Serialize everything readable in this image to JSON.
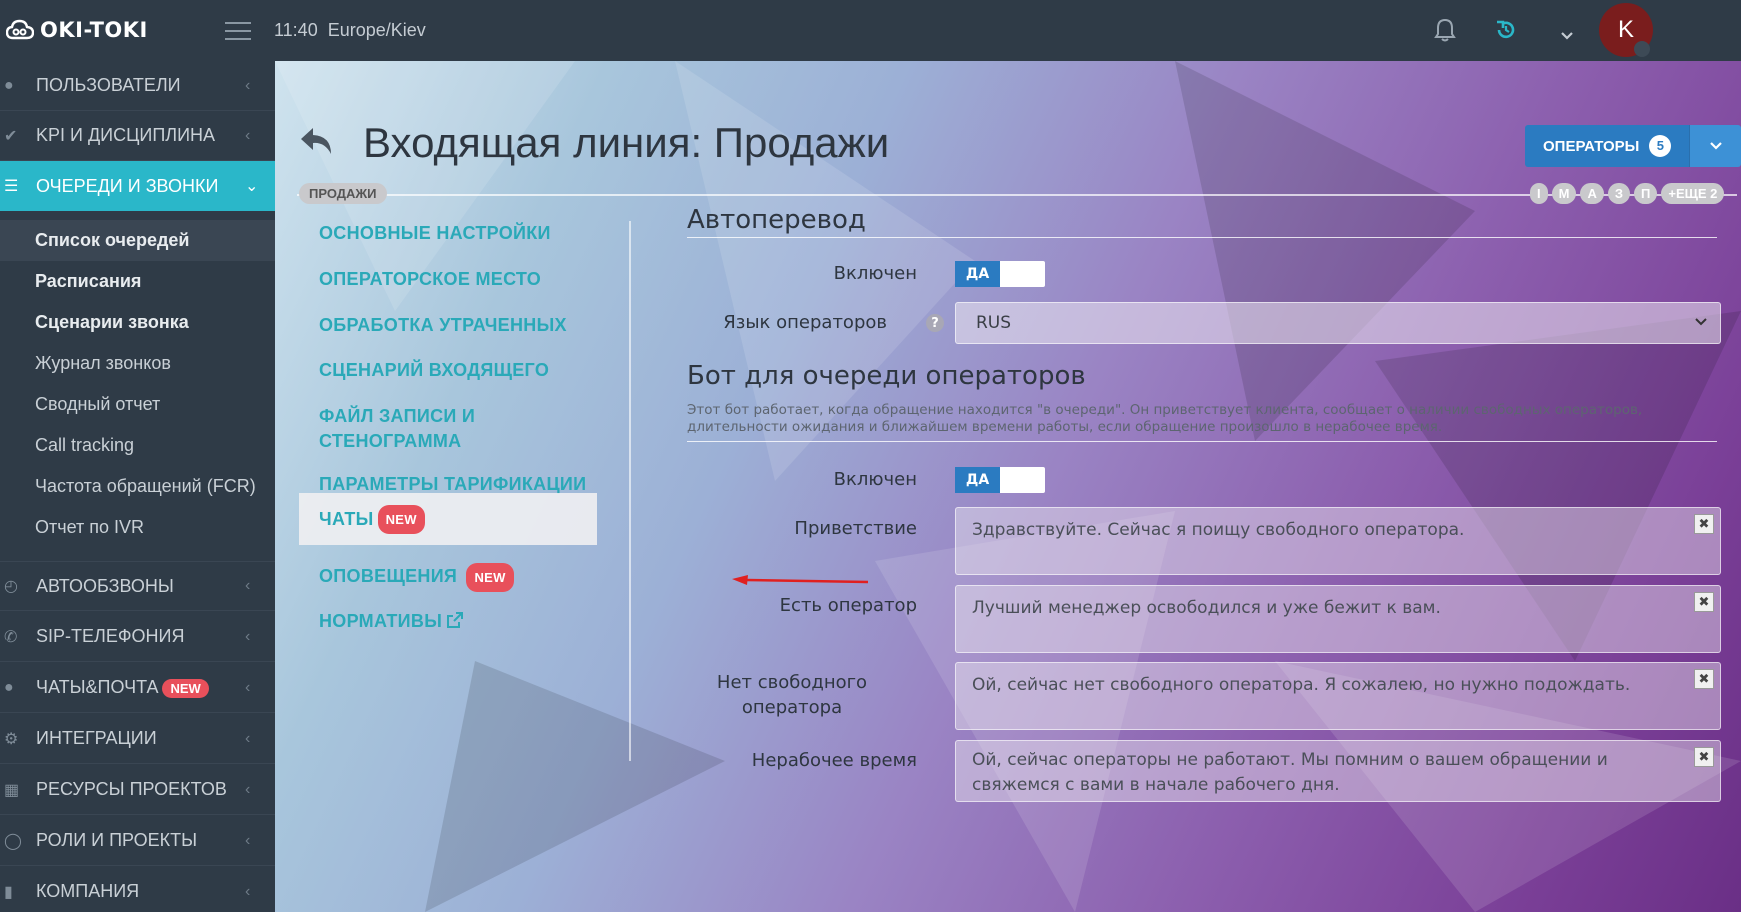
{
  "topbar": {
    "logo": "OKI-TOKI",
    "time": "11:40",
    "timezone": "Europe/Kiev",
    "avatar_letter": "K",
    "icons": [
      "menu-icon",
      "bell-icon",
      "refresh-icon",
      "chevron-down-icon"
    ]
  },
  "sidebar": {
    "items": [
      {
        "label": "ПОЛЬЗОВАТЕЛИ",
        "icon": "user-icon"
      },
      {
        "label": "KPI И ДИСЦИПЛИНА",
        "icon": "check-icon"
      },
      {
        "label": "ОЧЕРЕДИ И ЗВОНКИ",
        "icon": "list-icon",
        "active": true
      },
      {
        "label": "АВТООБЗВОНЫ",
        "icon": "clock-icon"
      },
      {
        "label": "SIP-ТЕЛЕФОНИЯ",
        "icon": "phone-icon"
      },
      {
        "label": "ЧАТЫ&ПОЧТА",
        "icon": "chat-icon",
        "badge": "NEW"
      },
      {
        "label": "ИНТЕГРАЦИИ",
        "icon": "gears-icon"
      },
      {
        "label": "РЕСУРСЫ ПРОЕКТОВ",
        "icon": "grid-icon"
      },
      {
        "label": "РОЛИ И ПРОЕКТЫ",
        "icon": "toggle-icon"
      },
      {
        "label": "КОМПАНИЯ",
        "icon": "bar-chart-icon"
      }
    ],
    "subitems": [
      {
        "label": "Список очередей"
      },
      {
        "label": "Расписания"
      },
      {
        "label": "Сценарии звонка"
      },
      {
        "label": "Журнал звонков"
      },
      {
        "label": "Сводный отчет"
      },
      {
        "label": "Call tracking"
      },
      {
        "label": "Частота обращений (FCR)"
      },
      {
        "label": "Отчет по IVR"
      }
    ]
  },
  "header": {
    "title": "Входящая линия: Продажи",
    "breadcrumb": "ПРОДАЖИ",
    "operators_label": "ОПЕРАТОРЫ",
    "operators_count": "5",
    "operator_pills": [
      "I",
      "M",
      "A",
      "З",
      "П",
      "+ЕЩЕ 2"
    ]
  },
  "settings_menu": [
    {
      "label": "ОСНОВНЫЕ НАСТРОЙКИ"
    },
    {
      "label": "ОПЕРАТОРСКОЕ МЕСТО"
    },
    {
      "label": "ОБРАБОТКА УТРАЧЕННЫХ"
    },
    {
      "label": "СЦЕНАРИЙ ВХОДЯЩЕГО"
    },
    {
      "label": "ФАЙЛ ЗАПИСИ И СТЕНОГРАММА"
    },
    {
      "label": "ПАРАМЕТРЫ ТАРИФИКАЦИИ"
    },
    {
      "label": "ЧАТЫ",
      "badge": "NEW",
      "active": true
    },
    {
      "label": "ОПОВЕЩЕНИЯ",
      "badge": "NEW"
    },
    {
      "label": "НОРМАТИВЫ",
      "icon": "external-link-icon"
    }
  ],
  "autotranslate": {
    "title": "Автоперевод",
    "enabled_label": "Включен",
    "enabled_value": "ДА",
    "language_label": "Язык операторов",
    "language_value": "RUS"
  },
  "bot": {
    "title": "Бот для очереди операторов",
    "description": "Этот бот работает, когда обращение находится \"в очереди\". Он приветствует клиента, сообщает о наличии свободных операторов, длительности ожидания и ближайшем времени работы, если обращение произошло в нерабочее время.",
    "enabled_label": "Включен",
    "enabled_value": "ДА",
    "fields": [
      {
        "label": "Приветствие",
        "value": "Здравствуйте. Сейчас я поищу свободного оператора."
      },
      {
        "label": "Есть оператор",
        "value": "Лучший менеджер освободился и уже бежит к вам."
      },
      {
        "label": "Нет свободного оператора",
        "value": "Ой, сейчас нет свободного оператора. Я сожалею, но нужно подождать."
      },
      {
        "label": "Нерабочее время",
        "value": "Ой, сейчас операторы не работают. Мы помним о вашем обращении и свяжемся с вами в начале рабочего дня."
      }
    ]
  },
  "colors": {
    "accent": "#2ab7c9",
    "primary_button": "#2b7bc1",
    "badge_new": "#e8505b"
  }
}
